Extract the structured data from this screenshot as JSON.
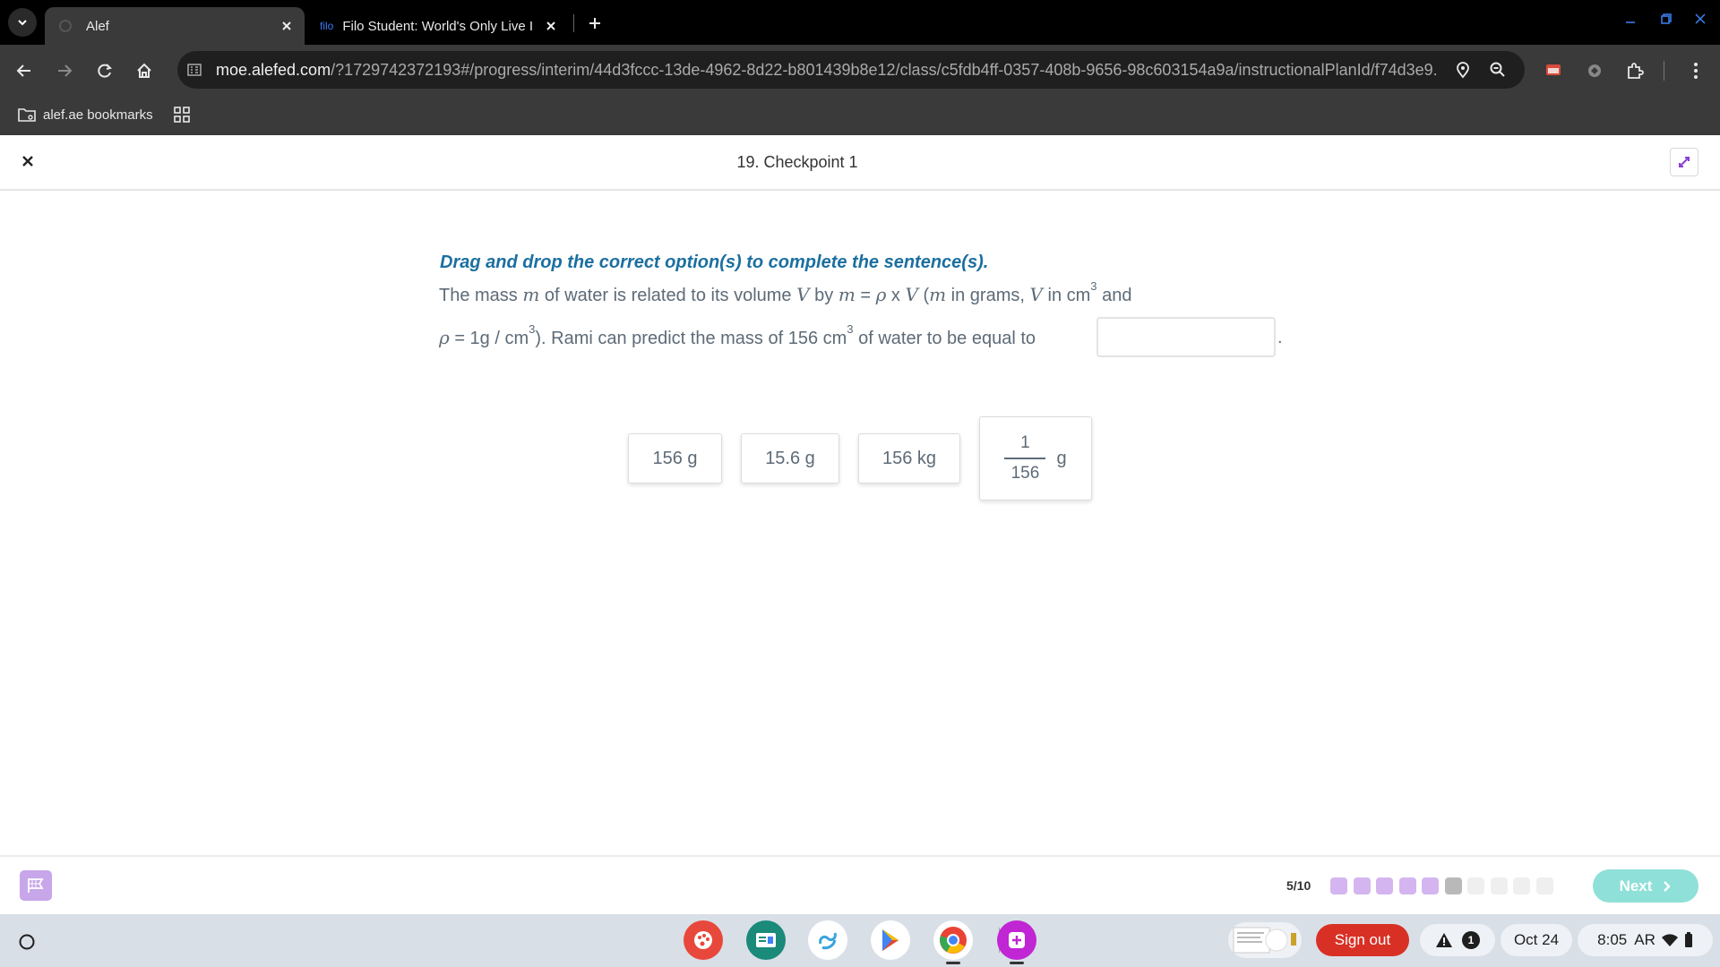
{
  "browser": {
    "tabs": [
      {
        "title": "Alef",
        "favicon": "alef-favicon-icon",
        "active": true
      },
      {
        "title": "Filo Student: World's Only Live I",
        "favicon_text": "filo",
        "active": false
      }
    ],
    "url_host": "moe.alefed.com",
    "url_path": "/?1729742372193#/progress/interim/44d3fccc-13de-4962-8d22-b801439b8e12/class/c5fdb4ff-0357-408b-9656-98c603154a9a/instructionalPlanId/f74d3e9...",
    "bookmark_label": "alef.ae bookmarks"
  },
  "app": {
    "page_title": "19. Checkpoint 1",
    "instruction": "Drag and drop the correct option(s) to complete the sentence(s).",
    "sentence": {
      "p1": "The mass ",
      "m": "m",
      "p2": " of water is related to its volume ",
      "V": "V",
      "p3": " by ",
      "eq_m": "m",
      "eq_eq": " = ",
      "eq_rho": "ρ",
      "eq_x": " x ",
      "eq_V": "V",
      "p4": " (",
      "m2": "m",
      "p5": " in grams, ",
      "V2": "V",
      "p6": " in  cm",
      "sup3": "3",
      "p7": " and",
      "rho2": "ρ",
      "l2a": "  =  1g / cm",
      "l2b": "). Rami can predict the mass of 156  cm",
      "l2c": " of water to be equal to",
      "dot": "."
    },
    "options": [
      {
        "label": "156 g"
      },
      {
        "label": "15.6 g"
      },
      {
        "label": "156 kg"
      },
      {
        "numerator": "1",
        "denominator": "156",
        "unit": "g"
      }
    ],
    "progress": {
      "label": "5/10",
      "current": 5,
      "total": 10,
      "colors": {
        "done": "#d4b5f0",
        "current": "#b9b9b9",
        "todo": "#efefef"
      }
    },
    "next_label": "Next"
  },
  "shelf": {
    "signout_label": "Sign out",
    "notification_count": "1",
    "date": "Oct 24",
    "time": "8:05",
    "locale": "AR"
  },
  "colors": {
    "instruction": "#1b6fa0",
    "next_button": "#8fe0d8",
    "flag_button": "#c7a6ea",
    "signout": "#d93025"
  }
}
